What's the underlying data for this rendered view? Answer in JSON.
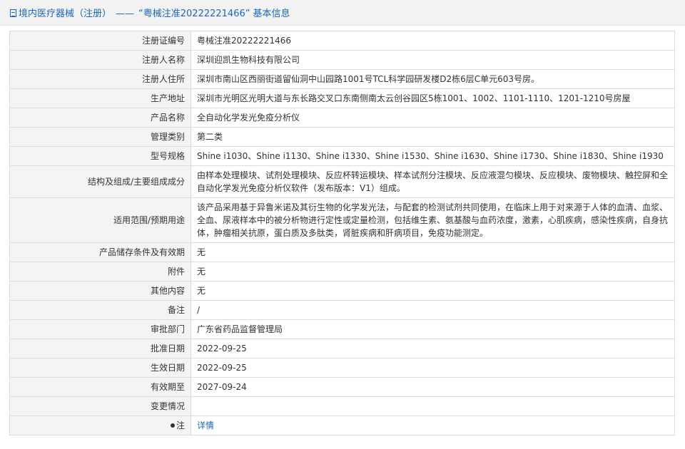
{
  "header": {
    "category": "境内医疗器械（注册）",
    "separator": "——",
    "reg_no_quoted": "“粤械注准20222221466”",
    "suffix": "基本信息"
  },
  "rows": [
    {
      "label": "注册证编号",
      "value": "粤械注准20222221466"
    },
    {
      "label": "注册人名称",
      "value": "深圳迎凯生物科技有限公司"
    },
    {
      "label": "注册人住所",
      "value": "深圳市南山区西丽街道留仙洞中山园路1001号TCL科学园研发楼D2栋6层C单元603号房。"
    },
    {
      "label": "生产地址",
      "value": "深圳市光明区光明大道与东长路交叉口东南侧南太云创谷园区5栋1001、1002、1101-1110、1201-1210号房屋"
    },
    {
      "label": "产品名称",
      "value": "全自动化学发光免疫分析仪"
    },
    {
      "label": "管理类别",
      "value": "第二类"
    },
    {
      "label": "型号规格",
      "value": "Shine i1030、Shine i1130、Shine i1330、Shine i1530、Shine i1630、Shine i1730、Shine i1830、Shine i1930"
    },
    {
      "label": "结构及组成/主要组成成分",
      "value": "由样本处理模块、试剂处理模块、反应杯转运模块、样本试剂分注模块、反应液混匀模块、反应模块、废物模块、触控屏和全自动化学发光免疫分析仪软件（发布版本：V1）组成。"
    },
    {
      "label": "适用范围/预期用途",
      "value": "该产品采用基于异鲁米诺及其衍生物的化学发光法，与配套的检测试剂共同使用，在临床上用于对来源于人体的血清、血浆、全血、尿液样本中的被分析物进行定性或定量检测，包括维生素、氨基酸与血药浓度，激素，心肌疾病，感染性疾病，自身抗体，肿瘤相关抗原，蛋白质及多肽类，肾脏疾病和肝病项目，免疫功能测定。"
    },
    {
      "label": "产品储存条件及有效期",
      "value": "无"
    },
    {
      "label": "附件",
      "value": "无"
    },
    {
      "label": "其他内容",
      "value": "无"
    },
    {
      "label": "备注",
      "value": "/"
    },
    {
      "label": "审批部门",
      "value": "广东省药品监督管理局"
    },
    {
      "label": "批准日期",
      "value": "2022-09-25"
    },
    {
      "label": "生效日期",
      "value": "2022-09-25"
    },
    {
      "label": "有效期至",
      "value": "2027-09-24"
    },
    {
      "label": "变更情况",
      "value": ""
    },
    {
      "label": "注",
      "value": "详情",
      "icon": "pin-icon"
    }
  ]
}
